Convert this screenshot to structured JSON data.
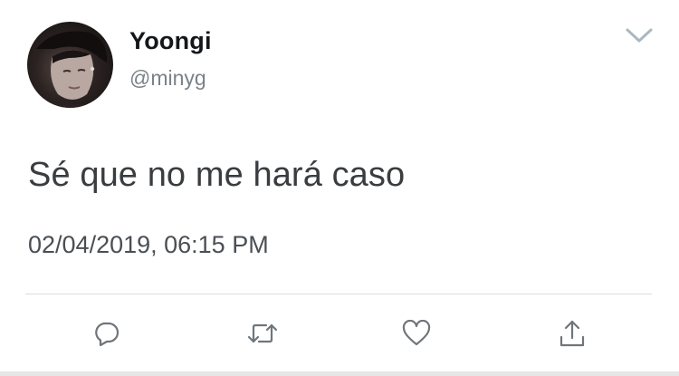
{
  "user": {
    "display_name": "Yoongi",
    "handle": "@minyg",
    "avatar_icon": "user-photo-avatar"
  },
  "tweet": {
    "text": "Sé que no me hará caso",
    "timestamp": "02/04/2019, 06:15 PM"
  },
  "header": {
    "menu_icon": "chevron-down-icon"
  },
  "actions": [
    {
      "name": "reply",
      "icon": "reply-icon"
    },
    {
      "name": "retweet",
      "icon": "retweet-icon"
    },
    {
      "name": "like",
      "icon": "heart-icon"
    },
    {
      "name": "share",
      "icon": "share-icon"
    }
  ],
  "colors": {
    "text_primary": "#14171a",
    "text_secondary": "#7a8288",
    "icon": "#6f767b",
    "divider": "#d8dcdf"
  }
}
